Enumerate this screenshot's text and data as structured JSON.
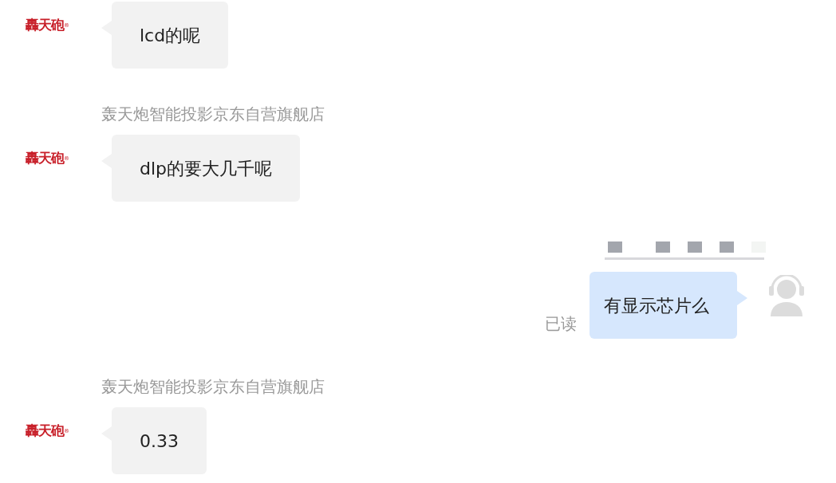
{
  "messages": [
    {
      "kind": "received",
      "logo": "轟天砲$^{®}$",
      "text": "lcd的呢"
    },
    {
      "kind": "received",
      "sender": "轰天炮智能投影京东自营旗舰店",
      "logo": "轟天砲$^{®}$",
      "text": "dlp的要大几千呢"
    },
    {
      "kind": "sent",
      "status": "已读",
      "text": "有显示芯片么"
    },
    {
      "kind": "received",
      "sender": "轰天炮智能投影京东自营旗舰店",
      "logo": "轟天砲$^{®}$",
      "text": "0.33"
    }
  ]
}
